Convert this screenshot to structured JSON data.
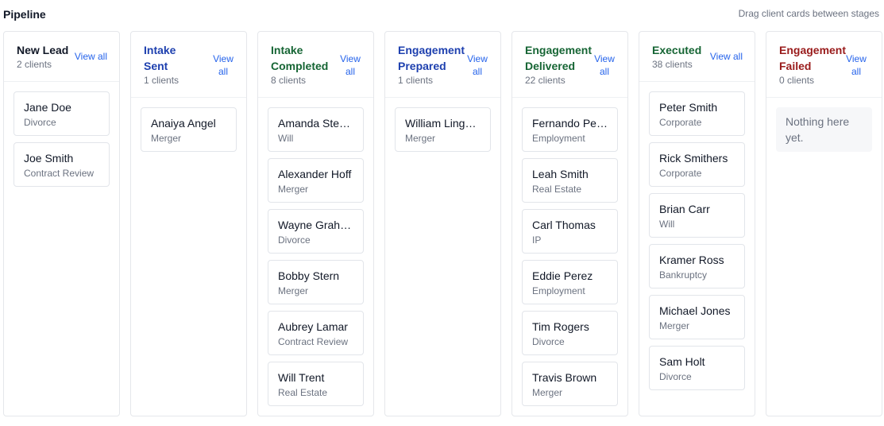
{
  "header": {
    "title": "Pipeline",
    "hint": "Drag client cards between stages"
  },
  "colors": {
    "new_lead": "#111827",
    "intake_sent": "#1e40af",
    "intake_completed": "#166534",
    "engagement_prepared": "#1e40af",
    "engagement_delivered": "#166534",
    "executed": "#166534",
    "engagement_failed": "#991b1b",
    "link": "#2563eb"
  },
  "columns": [
    {
      "title": "New Lead",
      "count": "2 clients",
      "view_all": "View all",
      "cards": [
        {
          "name": "Jane Doe",
          "type": "Divorce"
        },
        {
          "name": "Joe Smith",
          "type": "Contract Review"
        }
      ]
    },
    {
      "title": "Intake Sent",
      "count": "1 clients",
      "view_all": "View all",
      "cards": [
        {
          "name": "Anaiya Angel",
          "type": "Merger"
        }
      ]
    },
    {
      "title": "Intake Completed",
      "count": "8 clients",
      "view_all": "View all",
      "cards": [
        {
          "name": "Amanda Ste…",
          "type": "Will"
        },
        {
          "name": "Alexander Hoff",
          "type": "Merger"
        },
        {
          "name": "Wayne Grah…",
          "type": "Divorce"
        },
        {
          "name": "Bobby Stern",
          "type": "Merger"
        },
        {
          "name": "Aubrey Lamar",
          "type": "Contract Review"
        },
        {
          "name": "Will Trent",
          "type": "Real Estate"
        }
      ]
    },
    {
      "title": "Engagement Prepared",
      "count": "1 clients",
      "view_all": "View all",
      "cards": [
        {
          "name": "William Ling…",
          "type": "Merger"
        }
      ]
    },
    {
      "title": "Engagement Delivered",
      "count": "22 clients",
      "view_all": "View all",
      "cards": [
        {
          "name": "Fernando Pe…",
          "type": "Employment"
        },
        {
          "name": "Leah Smith",
          "type": "Real Estate"
        },
        {
          "name": "Carl Thomas",
          "type": "IP"
        },
        {
          "name": "Eddie Perez",
          "type": "Employment"
        },
        {
          "name": "Tim Rogers",
          "type": "Divorce"
        },
        {
          "name": "Travis Brown",
          "type": "Merger"
        }
      ]
    },
    {
      "title": "Executed",
      "count": "38 clients",
      "view_all": "View all",
      "cards": [
        {
          "name": "Peter Smith",
          "type": "Corporate"
        },
        {
          "name": "Rick Smithers",
          "type": "Corporate"
        },
        {
          "name": "Brian Carr",
          "type": "Will"
        },
        {
          "name": "Kramer Ross",
          "type": "Bankruptcy"
        },
        {
          "name": "Michael Jones",
          "type": "Merger"
        },
        {
          "name": "Sam Holt",
          "type": "Divorce"
        }
      ]
    },
    {
      "title": "Engagement Failed",
      "count": "0 clients",
      "view_all": "View all",
      "empty_text": "Nothing here yet.",
      "cards": []
    }
  ]
}
